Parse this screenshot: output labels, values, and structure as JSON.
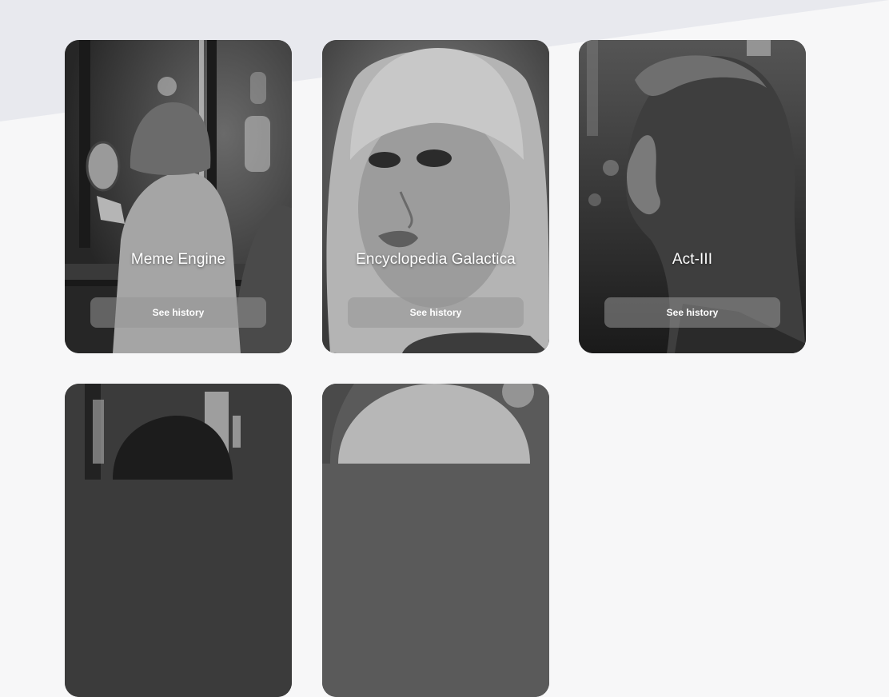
{
  "cards": [
    {
      "title": "Meme Engine",
      "button_label": "See history"
    },
    {
      "title": "Encyclopedia Galactica",
      "button_label": "See history"
    },
    {
      "title": "Act-III",
      "button_label": "See history"
    },
    {
      "title": "",
      "button_label": ""
    },
    {
      "title": "",
      "button_label": ""
    }
  ],
  "images": [
    "woman-with-mirror-photo",
    "woman-portrait-closeup-photo",
    "woman-profile-city-night-photo",
    "woman-back-neon-sign-photo",
    "woman-hair-closeup-photo"
  ]
}
